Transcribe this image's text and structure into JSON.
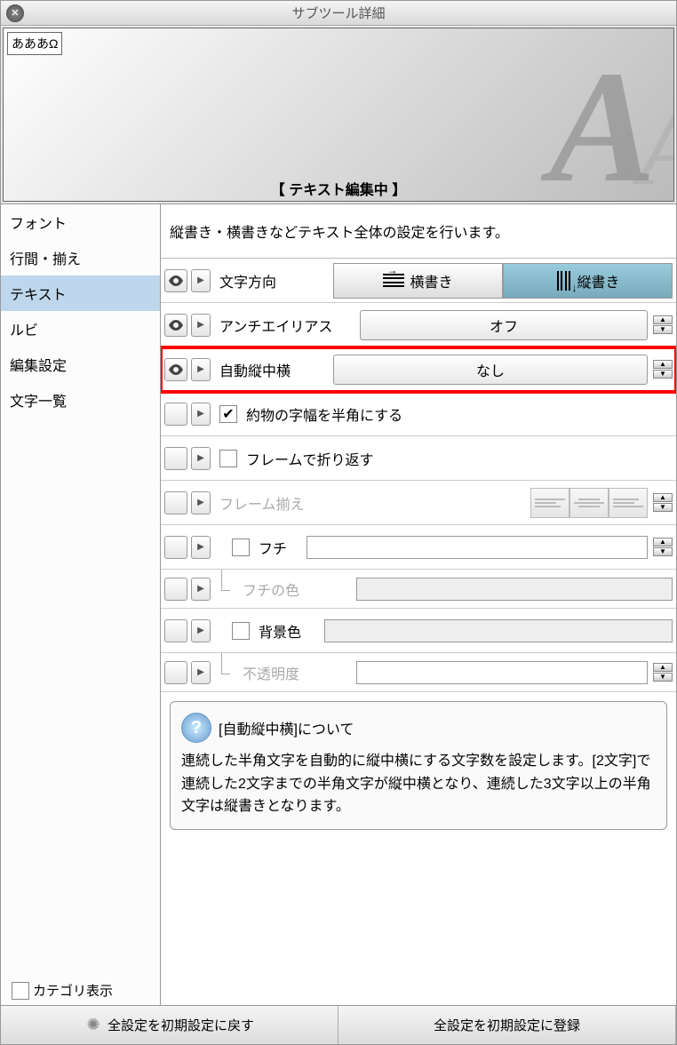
{
  "window": {
    "title": "サブツール詳細"
  },
  "preview": {
    "tag": "あああΩ",
    "status": "【 テキスト編集中 】"
  },
  "sidebar": {
    "items": [
      {
        "label": "フォント"
      },
      {
        "label": "行間・揃え"
      },
      {
        "label": "テキスト"
      },
      {
        "label": "ルビ"
      },
      {
        "label": "編集設定"
      },
      {
        "label": "文字一覧"
      }
    ],
    "category_show": "カテゴリ表示"
  },
  "main": {
    "description": "縦書き・横書きなどテキスト全体の設定を行います。",
    "rows": {
      "direction": {
        "label": "文字方向",
        "opt_h": "横書き",
        "opt_v": "縦書き"
      },
      "antialias": {
        "label": "アンチエイリアス",
        "value": "オフ"
      },
      "auto_tcy": {
        "label": "自動縦中横",
        "value": "なし"
      },
      "halfwidth": {
        "label": "約物の字幅を半角にする",
        "checked": true
      },
      "wrap": {
        "label": "フレームで折り返す",
        "checked": false
      },
      "frame_align": {
        "label": "フレーム揃え"
      },
      "edge": {
        "label": "フチ",
        "checked": false
      },
      "edge_color": {
        "label": "フチの色"
      },
      "bg": {
        "label": "背景色",
        "checked": false
      },
      "opacity": {
        "label": "不透明度"
      }
    }
  },
  "help": {
    "title": "[自動縦中横]について",
    "body": "連続した半角文字を自動的に縦中横にする文字数を設定します。[2文字]で連続した2文字までの半角文字が縦中横となり、連続した3文字以上の半角文字は縦書きとなります。"
  },
  "footer": {
    "reset": "全設定を初期設定に戻す",
    "register": "全設定を初期設定に登録"
  }
}
